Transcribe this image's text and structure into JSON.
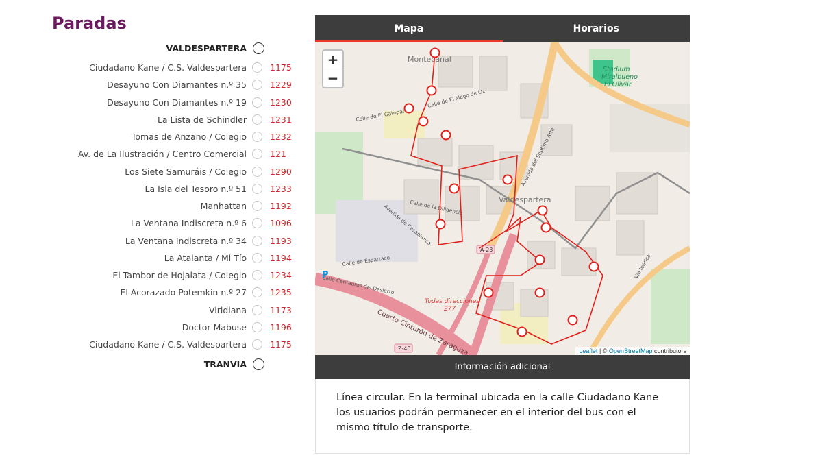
{
  "stops_section": {
    "title": "Paradas",
    "start_terminal": "VALDESPARTERA",
    "end_terminal": "TRANVIA",
    "stops": [
      {
        "name": "Ciudadano Kane / C.S. Valdespartera",
        "code": "1175"
      },
      {
        "name": "Desayuno Con Diamantes n.º 35",
        "code": "1229"
      },
      {
        "name": "Desayuno Con Diamantes n.º 19",
        "code": "1230"
      },
      {
        "name": "La Lista de Schindler",
        "code": "1231"
      },
      {
        "name": "Tomas de Anzano / Colegio",
        "code": "1232"
      },
      {
        "name": "Av. de La Ilustración / Centro Comercial",
        "code": "121"
      },
      {
        "name": "Los Siete Samuráis / Colegio",
        "code": "1290"
      },
      {
        "name": "La Isla del Tesoro n.º 51",
        "code": "1233"
      },
      {
        "name": "Manhattan",
        "code": "1192"
      },
      {
        "name": "La Ventana Indiscreta n.º 6",
        "code": "1096"
      },
      {
        "name": "La Ventana Indiscreta n.º 34",
        "code": "1193"
      },
      {
        "name": "La Atalanta / Mi Tío",
        "code": "1194"
      },
      {
        "name": "El Tambor de Hojalata / Colegio",
        "code": "1234"
      },
      {
        "name": "El Acorazado Potemkin n.º 27",
        "code": "1235"
      },
      {
        "name": "Viridiana",
        "code": "1173"
      },
      {
        "name": "Doctor Mabuse",
        "code": "1196"
      },
      {
        "name": "Ciudadano Kane / C.S. Valdespartera",
        "code": "1175"
      }
    ]
  },
  "tabs": [
    {
      "label": "Mapa",
      "active": true
    },
    {
      "label": "Horarios",
      "active": false
    }
  ],
  "map": {
    "zoom_in": "+",
    "zoom_out": "−",
    "labels": {
      "montecanal": "Montecanal",
      "valdespartera": "Valdespartera",
      "stadium": [
        "Stadium",
        "Miralbueno",
        "El Olivar"
      ],
      "calle_mago_oz": "Calle de El Mago de Oz",
      "calle_gatopardo": "Calle de El Gatopardo",
      "avenida_septimo_arte": "Avenida del Séptimo Arte",
      "calle_diligencia": "Calle de la Diligencia",
      "avenida_casablanca": "Avenida de Casablanca",
      "calle_expartaco": "Calle de Espartaco",
      "calle_centauros": "Calle Centauros del Desierto",
      "cuarto_cinturon": "Cuarto Cinturón de Zaragoza",
      "via_iberica": "Vía Ibérica",
      "a23": "A-23",
      "z40": "Z-40",
      "todas_direcciones": "Todas direcciones",
      "route_277": "277",
      "parking": "P"
    },
    "attribution": {
      "leaflet": "Leaflet",
      "separator": " | © ",
      "osm": "OpenStreetMap",
      "suffix": " contributors"
    },
    "route_color": "#e0201b"
  },
  "info": {
    "header": "Información adicional",
    "text": "Línea circular. En la terminal ubicada en la calle Ciudadano Kane los usuarios podrán permanecer en el interior del bus con el mismo título de transporte."
  },
  "colors": {
    "title": "#6b1c5e",
    "stop_code": "#d2262b",
    "tab_bar": "#3d3d3d",
    "tab_active_underline": "#e83b2d"
  }
}
